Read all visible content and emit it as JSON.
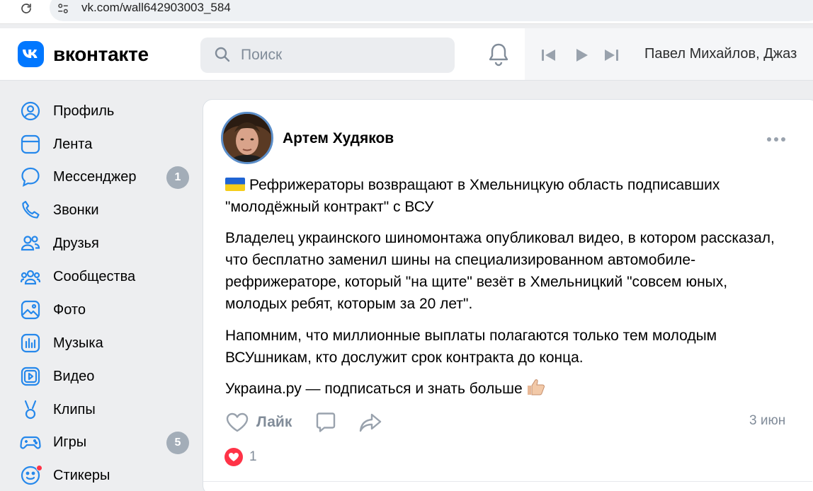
{
  "browser": {
    "url": "vk.com/wall642903003_584"
  },
  "header": {
    "logo_text": "вконтакте",
    "search_placeholder": "Поиск",
    "player_track": "Павел Михайлов, Джаз"
  },
  "nav": {
    "items": [
      {
        "label": "Профиль",
        "icon": "profile-icon"
      },
      {
        "label": "Лента",
        "icon": "feed-icon"
      },
      {
        "label": "Мессенджер",
        "icon": "messenger-icon",
        "badge": "1"
      },
      {
        "label": "Звонки",
        "icon": "calls-icon"
      },
      {
        "label": "Друзья",
        "icon": "friends-icon"
      },
      {
        "label": "Сообщества",
        "icon": "communities-icon"
      },
      {
        "label": "Фото",
        "icon": "photo-icon"
      },
      {
        "label": "Музыка",
        "icon": "music-icon"
      },
      {
        "label": "Видео",
        "icon": "video-icon"
      },
      {
        "label": "Клипы",
        "icon": "clips-icon"
      },
      {
        "label": "Игры",
        "icon": "games-icon",
        "badge": "5"
      },
      {
        "label": "Стикеры",
        "icon": "stickers-icon"
      }
    ]
  },
  "post": {
    "author": "Артем Худяков",
    "paragraphs": [
      "Рефрижераторы возвращают в Хмельницкую область подписавших \"молодёжный контракт\" с ВСУ",
      "Владелец украинского шиномонтажа опубликовал видео, в котором рассказал, что бесплатно заменил шины на специализированном автомобиле-рефрижераторе, который \"на щите\" везёт в Хмельницкий \"совсем юных, молодых ребят, которым за 20 лет\".",
      "Напомним, что миллионные выплаты полагаются только тем молодым ВСУшникам, кто дослужит срок контракта до конца.",
      "Украина.ру — подписаться и знать больше"
    ],
    "like_label": "Лайк",
    "date": "3 июн",
    "reaction_count": "1"
  },
  "colors": {
    "vk_blue": "#0077ff",
    "secondary_text": "#818c99",
    "nav_icon": "#2688eb",
    "badge": "#a3adb8",
    "reaction": "#ff3347"
  }
}
